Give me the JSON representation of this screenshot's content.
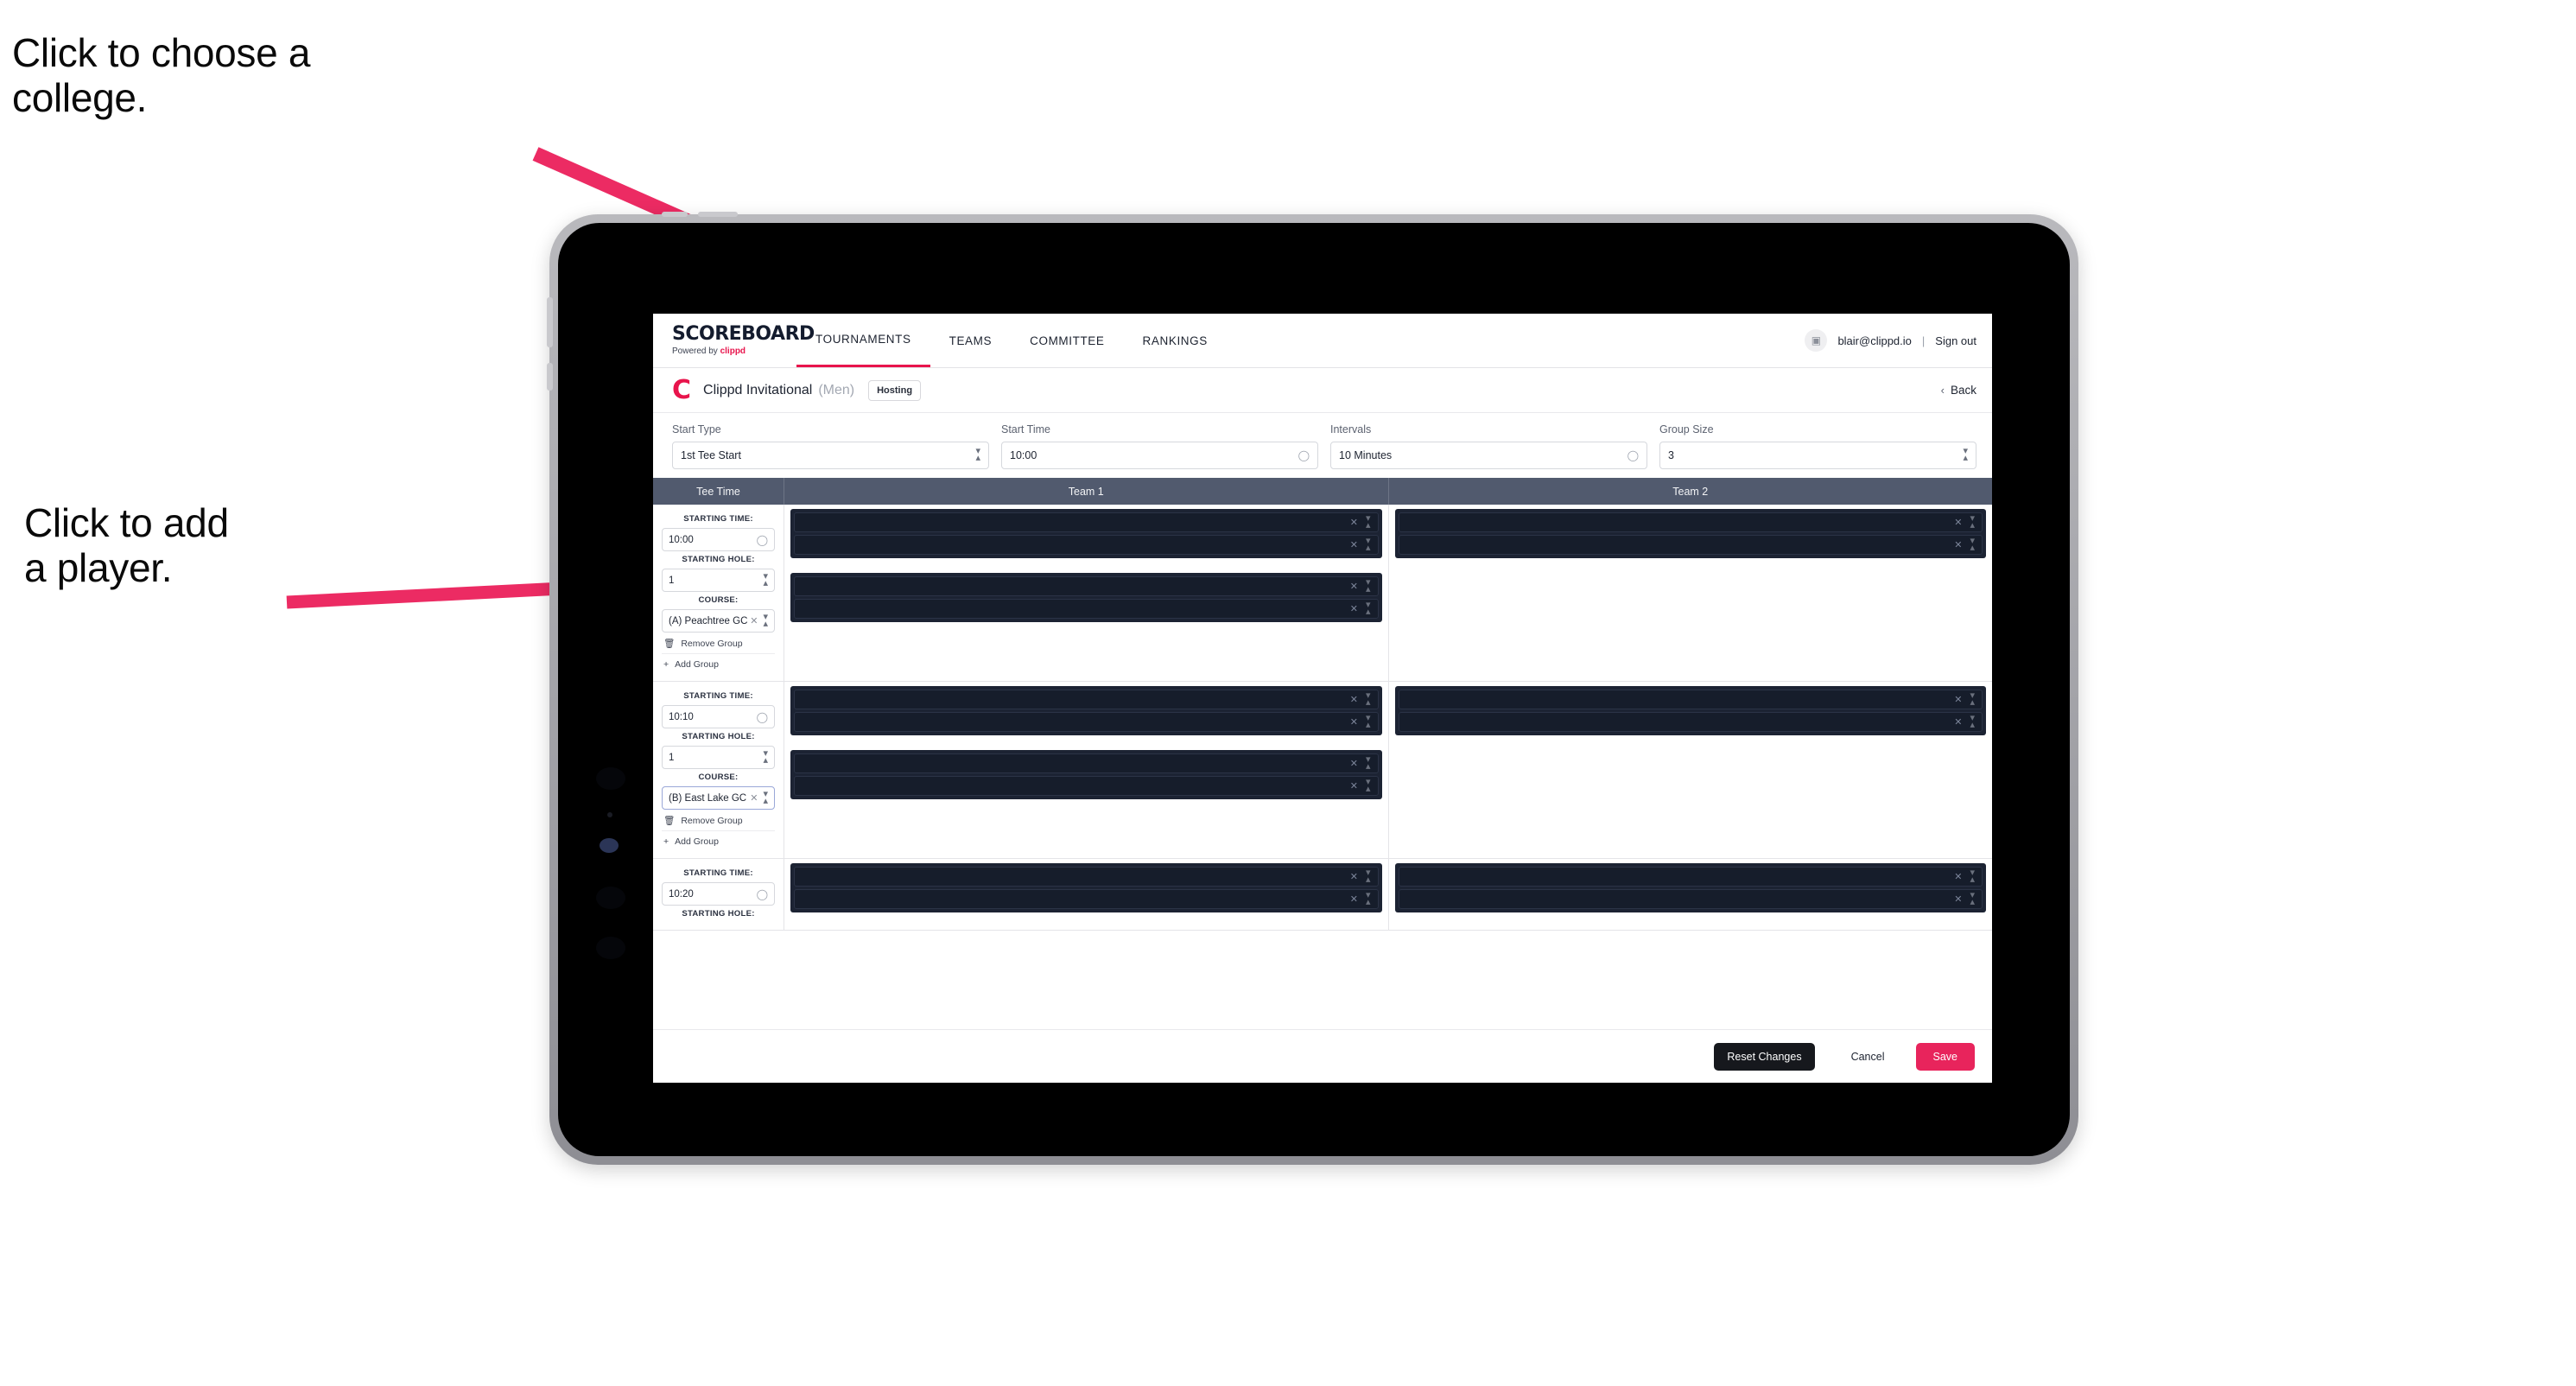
{
  "annotations": {
    "choose_college": "Click to choose a\ncollege.",
    "add_player": "Click to add\na player.",
    "arrow_color": "#ec2b63"
  },
  "nav": {
    "logo_main": "SCOREBOARD",
    "logo_sub_prefix": "Powered by ",
    "logo_sub_brand": "clippd",
    "items": [
      {
        "label": "TOURNAMENTS",
        "active": true
      },
      {
        "label": "TEAMS",
        "active": false
      },
      {
        "label": "COMMITTEE",
        "active": false
      },
      {
        "label": "RANKINGS",
        "active": false
      }
    ],
    "avatar_icon": "user-avatar-icon",
    "email": "blair@clippd.io",
    "separator": "|",
    "sign_out": "Sign out"
  },
  "tournament": {
    "logo_letter": "C",
    "name": "Clippd Invitational",
    "gender": "(Men)",
    "badge": "Hosting",
    "back_label": "Back",
    "back_icon": "chevron-left-icon"
  },
  "settings": [
    {
      "label": "Start Type",
      "value": "1st Tee Start",
      "icon": "stepper-icon"
    },
    {
      "label": "Start Time",
      "value": "10:00",
      "icon": "clock-icon"
    },
    {
      "label": "Intervals",
      "value": "10 Minutes",
      "icon": "clock-icon"
    },
    {
      "label": "Group Size",
      "value": "3",
      "icon": "stepper-icon"
    }
  ],
  "table": {
    "headers": [
      "Tee Time",
      "Team 1",
      "Team 2"
    ],
    "captions": {
      "time": "STARTING TIME:",
      "hole": "STARTING HOLE:",
      "course": "COURSE:"
    },
    "actions": {
      "remove_group": "Remove Group",
      "add_group": "Add Group",
      "remove_icon": "trash-icon",
      "add_icon": "plus-icon"
    },
    "row_icons": {
      "clear": "clear-x-icon",
      "stepper": "stepper-icon",
      "clock": "clock-icon"
    },
    "groups": [
      {
        "starting_time": "10:00",
        "starting_hole": "1",
        "course": "(A) Peachtree GC",
        "course_focused": false,
        "team1_blocks": [
          2,
          2
        ],
        "team2_blocks": [
          2
        ]
      },
      {
        "starting_time": "10:10",
        "starting_hole": "1",
        "course": "(B) East Lake GC",
        "course_focused": true,
        "team1_blocks": [
          2,
          2
        ],
        "team2_blocks": [
          2
        ]
      },
      {
        "starting_time": "10:20",
        "starting_hole": "",
        "course": "",
        "course_focused": false,
        "team1_blocks": [
          2
        ],
        "team2_blocks": [
          2
        ]
      }
    ]
  },
  "footer": {
    "reset": "Reset Changes",
    "cancel": "Cancel",
    "save": "Save"
  },
  "colors": {
    "brand_pink": "#e8144c",
    "save_pink": "#e8245c",
    "header_slate": "#515a6e",
    "dark_row": "#161d2b"
  }
}
